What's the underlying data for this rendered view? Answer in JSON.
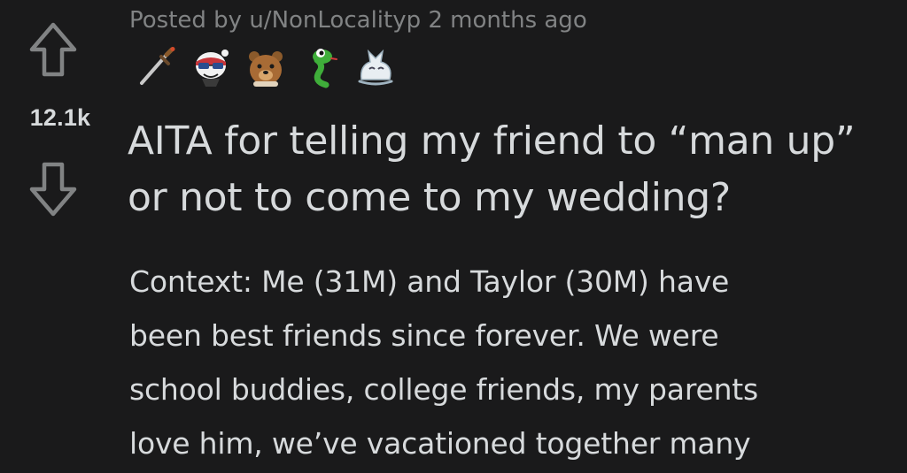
{
  "post": {
    "meta": {
      "prefix": "Posted by",
      "author": "u/NonLocalityp",
      "time": "2 months ago"
    },
    "score": "12.1k",
    "awards": [
      {
        "icon": "dagger-award-icon"
      },
      {
        "icon": "wholesome-seal-award-icon"
      },
      {
        "icon": "bear-award-icon"
      },
      {
        "icon": "snake-award-icon"
      },
      {
        "icon": "cat-award-icon"
      }
    ],
    "title": "AITA for telling my friend to “man up” or not to come to my wedding?",
    "body_lines": [
      "Context: Me (31M) and Taylor (30M) have",
      "been best friends since forever. We were",
      "school buddies, college friends, my parents",
      "love him, we’ve vacationed together many"
    ]
  },
  "colors": {
    "background": "#1a1a1b",
    "text": "#d7dadc",
    "meta": "#818384",
    "arrow": "#818384"
  }
}
